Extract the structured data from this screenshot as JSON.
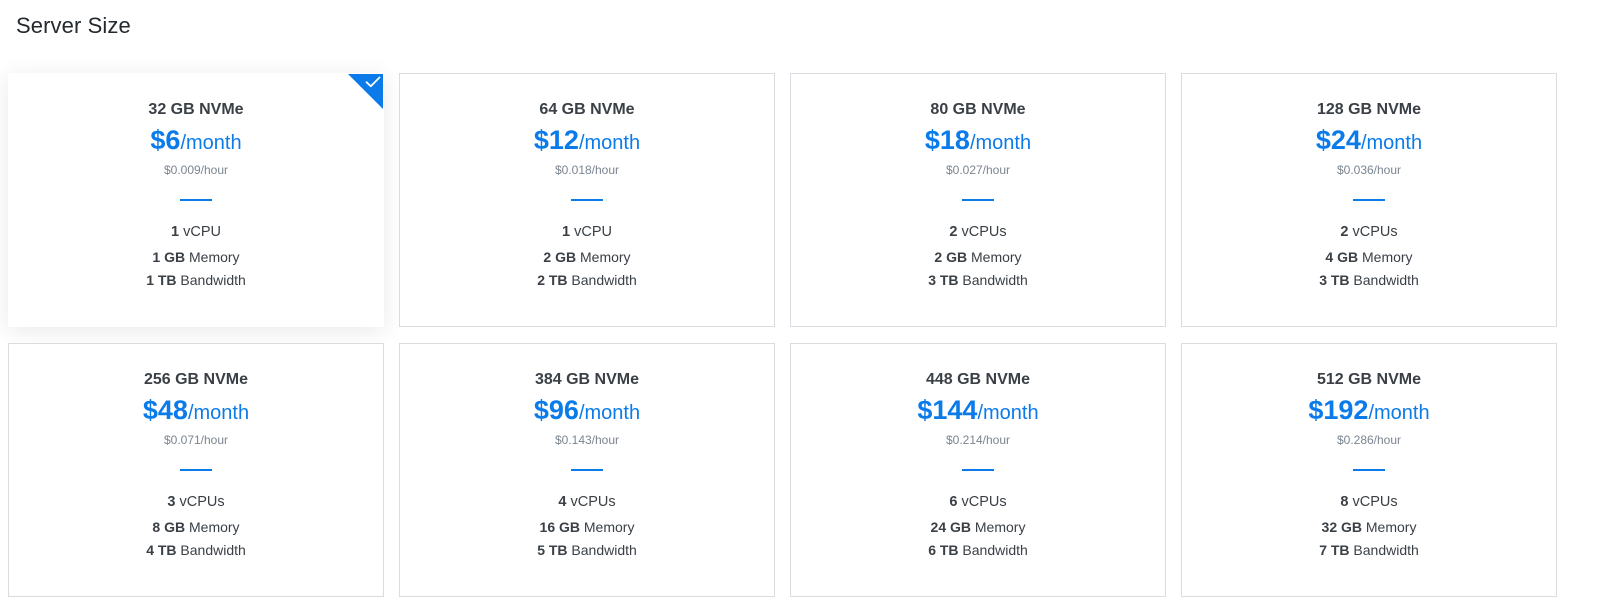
{
  "section": {
    "title": "Server Size"
  },
  "colors": {
    "accent": "#0b7bea",
    "border": "#d9dde1"
  },
  "selected_index": 0,
  "plans": [
    {
      "disk": "32 GB NVMe",
      "price": "$6",
      "per": "/month",
      "hourly": "$0.009/hour",
      "cpu_count": "1",
      "cpu_label": "vCPU",
      "mem": "1 GB",
      "mem_label": "Memory",
      "bw": "1 TB",
      "bw_label": "Bandwidth"
    },
    {
      "disk": "64 GB NVMe",
      "price": "$12",
      "per": "/month",
      "hourly": "$0.018/hour",
      "cpu_count": "1",
      "cpu_label": "vCPU",
      "mem": "2 GB",
      "mem_label": "Memory",
      "bw": "2 TB",
      "bw_label": "Bandwidth"
    },
    {
      "disk": "80 GB NVMe",
      "price": "$18",
      "per": "/month",
      "hourly": "$0.027/hour",
      "cpu_count": "2",
      "cpu_label": "vCPUs",
      "mem": "2 GB",
      "mem_label": "Memory",
      "bw": "3 TB",
      "bw_label": "Bandwidth"
    },
    {
      "disk": "128 GB NVMe",
      "price": "$24",
      "per": "/month",
      "hourly": "$0.036/hour",
      "cpu_count": "2",
      "cpu_label": "vCPUs",
      "mem": "4 GB",
      "mem_label": "Memory",
      "bw": "3 TB",
      "bw_label": "Bandwidth"
    },
    {
      "disk": "256 GB NVMe",
      "price": "$48",
      "per": "/month",
      "hourly": "$0.071/hour",
      "cpu_count": "3",
      "cpu_label": "vCPUs",
      "mem": "8 GB",
      "mem_label": "Memory",
      "bw": "4 TB",
      "bw_label": "Bandwidth"
    },
    {
      "disk": "384 GB NVMe",
      "price": "$96",
      "per": "/month",
      "hourly": "$0.143/hour",
      "cpu_count": "4",
      "cpu_label": "vCPUs",
      "mem": "16 GB",
      "mem_label": "Memory",
      "bw": "5 TB",
      "bw_label": "Bandwidth"
    },
    {
      "disk": "448 GB NVMe",
      "price": "$144",
      "per": "/month",
      "hourly": "$0.214/hour",
      "cpu_count": "6",
      "cpu_label": "vCPUs",
      "mem": "24 GB",
      "mem_label": "Memory",
      "bw": "6 TB",
      "bw_label": "Bandwidth"
    },
    {
      "disk": "512 GB NVMe",
      "price": "$192",
      "per": "/month",
      "hourly": "$0.286/hour",
      "cpu_count": "8",
      "cpu_label": "vCPUs",
      "mem": "32 GB",
      "mem_label": "Memory",
      "bw": "7 TB",
      "bw_label": "Bandwidth"
    }
  ]
}
